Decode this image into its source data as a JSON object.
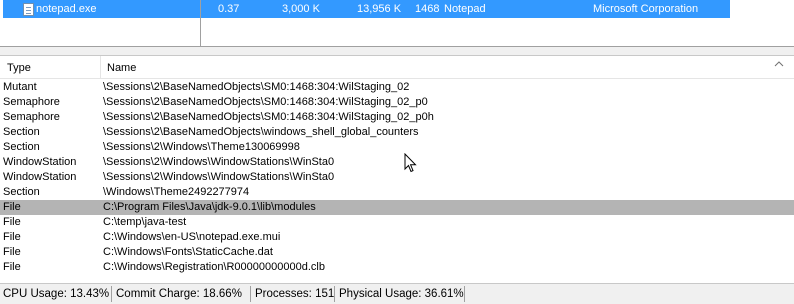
{
  "process": {
    "name": "notepad.exe",
    "cpu": "0.37",
    "private_bytes": "3,000 K",
    "working_set": "13,956 K",
    "pid": "1468",
    "description": "Notepad",
    "company": "Microsoft Corporation",
    "icon": "notepad-icon"
  },
  "handles": {
    "columns": [
      "Type",
      "Name"
    ],
    "sort_indicator": "chevron-up-icon",
    "rows": [
      {
        "type": "Mutant",
        "name": "\\Sessions\\2\\BaseNamedObjects\\SM0:1468:304:WilStaging_02"
      },
      {
        "type": "Semaphore",
        "name": "\\Sessions\\2\\BaseNamedObjects\\SM0:1468:304:WilStaging_02_p0"
      },
      {
        "type": "Semaphore",
        "name": "\\Sessions\\2\\BaseNamedObjects\\SM0:1468:304:WilStaging_02_p0h"
      },
      {
        "type": "Section",
        "name": "\\Sessions\\2\\BaseNamedObjects\\windows_shell_global_counters"
      },
      {
        "type": "Section",
        "name": "\\Sessions\\2\\Windows\\Theme130069998"
      },
      {
        "type": "WindowStation",
        "name": "\\Sessions\\2\\Windows\\WindowStations\\WinSta0"
      },
      {
        "type": "WindowStation",
        "name": "\\Sessions\\2\\Windows\\WindowStations\\WinSta0"
      },
      {
        "type": "Section",
        "name": "\\Windows\\Theme2492277974"
      },
      {
        "type": "File",
        "name": "C:\\Program Files\\Java\\jdk-9.0.1\\lib\\modules",
        "selected": true
      },
      {
        "type": "File",
        "name": "C:\\temp\\java-test"
      },
      {
        "type": "File",
        "name": "C:\\Windows\\en-US\\notepad.exe.mui"
      },
      {
        "type": "File",
        "name": "C:\\Windows\\Fonts\\StaticCache.dat"
      },
      {
        "type": "File",
        "name": "C:\\Windows\\Registration\\R00000000000d.clb"
      }
    ]
  },
  "status_bar": {
    "cpu_usage": "CPU Usage: 13.43%",
    "commit_charge": "Commit Charge: 18.66%",
    "processes": "Processes: 151",
    "physical_usage": "Physical Usage: 36.61%"
  },
  "colors": {
    "selection_active": "#3399ff",
    "selection_inactive": "#b4b4b4"
  }
}
